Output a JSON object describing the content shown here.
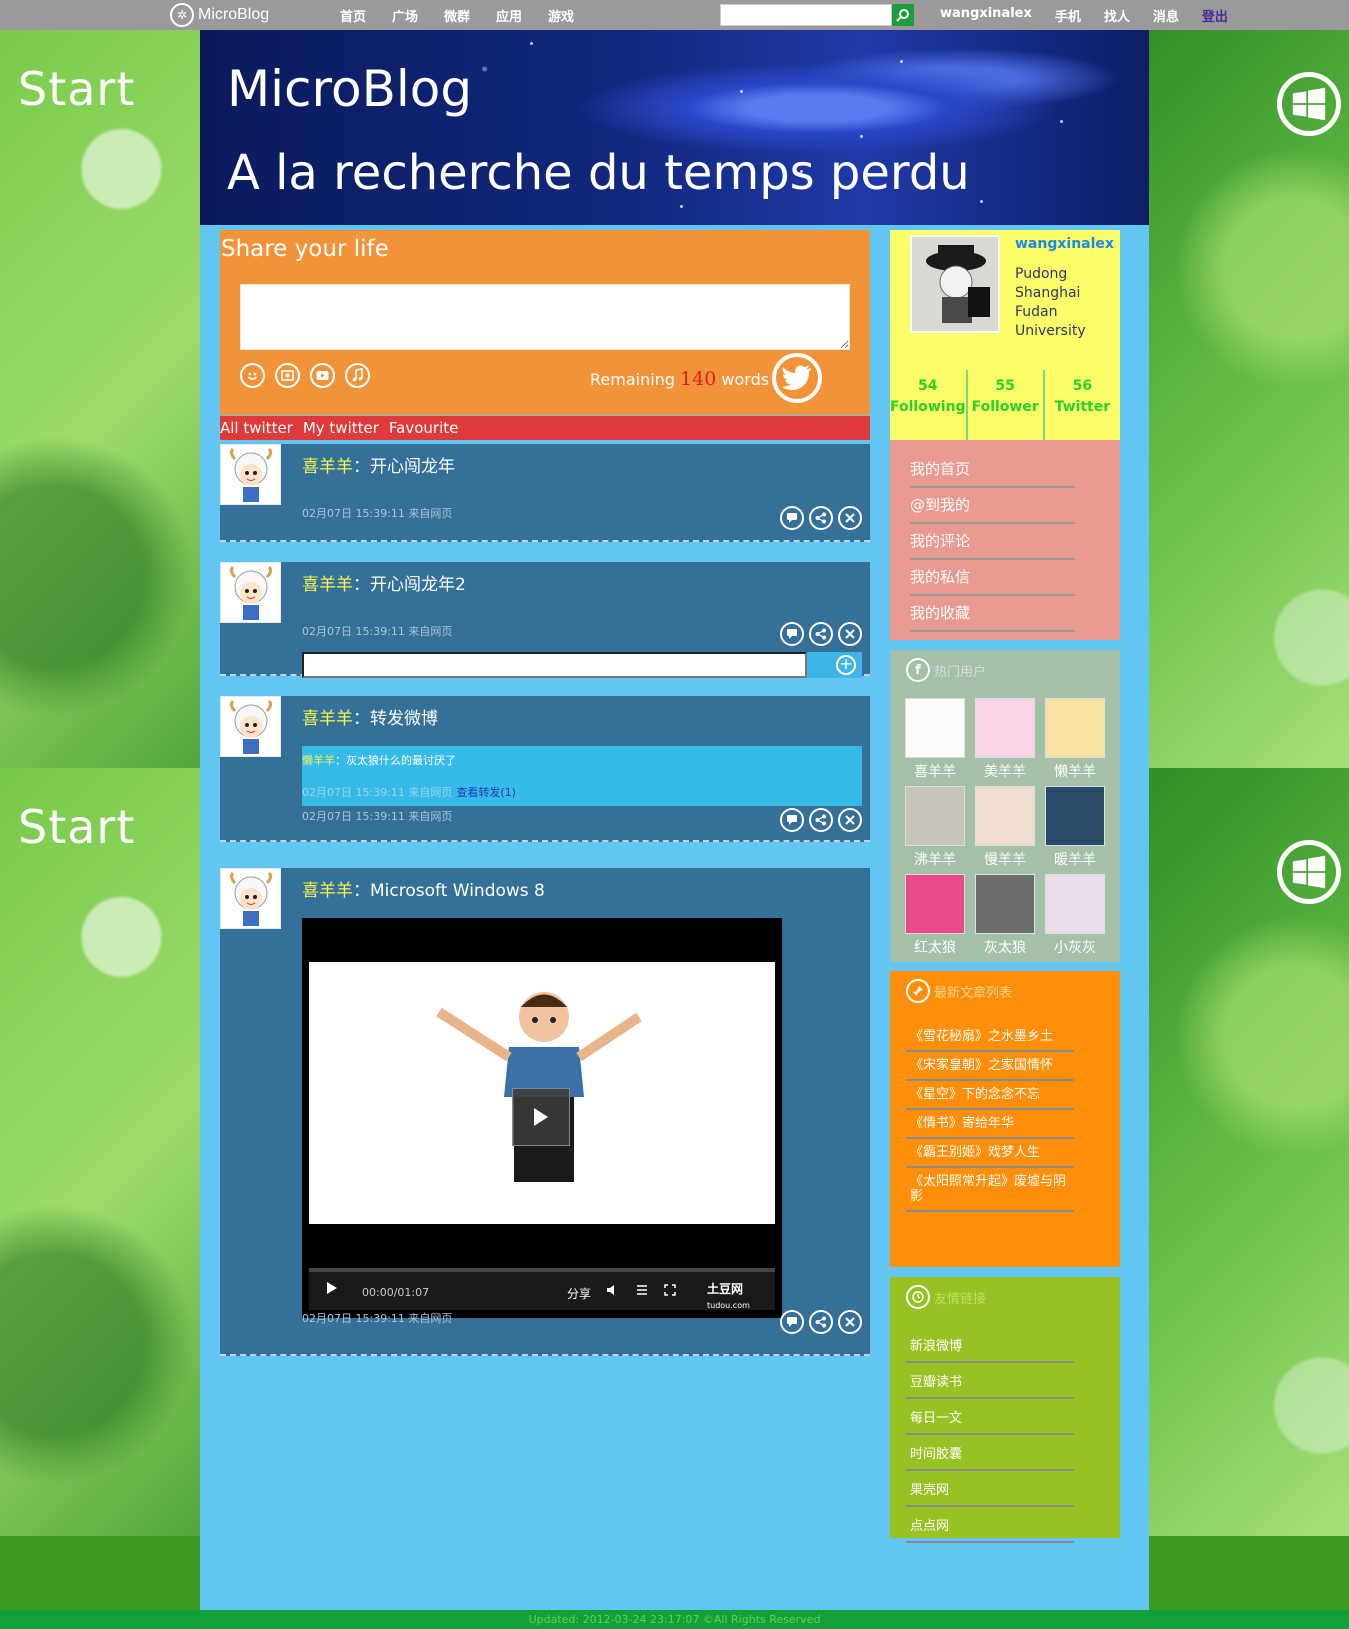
{
  "background": {
    "start_label_top": "Start",
    "start_label_bottom": "Start",
    "windows_logo_icon": "windows-logo-icon"
  },
  "topnav": {
    "brand": "MicroBlog",
    "links": [
      "首页",
      "广场",
      "微群",
      "应用",
      "游戏"
    ],
    "search_placeholder": "",
    "search_icon": "search-icon",
    "username": "wangxinalex",
    "user_links": [
      "手机",
      "找人",
      "消息"
    ],
    "logout": "登出"
  },
  "banner": {
    "title": "MicroBlog",
    "subtitle": "A la recherche du temps perdu"
  },
  "share": {
    "title": "Share your life",
    "input_value": "",
    "icons": [
      "smiley-icon",
      "image-icon",
      "video-icon",
      "music-icon"
    ],
    "remaining_prefix": "Remaining ",
    "remaining_count": "140",
    "remaining_suffix": " words",
    "post_button_icon": "twitter-bird-icon"
  },
  "tabs": [
    "All twitter",
    "My twitter",
    "Favourite"
  ],
  "posts": [
    {
      "author": "喜羊羊",
      "separator": "：",
      "text": "开心闯龙年",
      "meta": "02月07日 15:39:11 来自网页"
    },
    {
      "author": "喜羊羊",
      "separator": "：",
      "text": "开心闯龙年2",
      "meta": "02月07日 15:39:11 来自网页",
      "reply_value": ""
    },
    {
      "author": "喜羊羊",
      "separator": "：",
      "text": "转发微博",
      "repost": {
        "author": "懒羊羊",
        "separator": "：",
        "text": "灰太狼什么的最讨厌了",
        "meta": "02月07日 15:39:11 来自网页",
        "link": "查看转发(1)"
      },
      "meta": "02月07日 15:39:11 来自网页"
    },
    {
      "author": "喜羊羊",
      "separator": "：",
      "text": "Microsoft Windows 8",
      "video": {
        "time": "00:00/01:07",
        "share": "分享",
        "brand": "土豆网",
        "brand_sub": "tudou.com"
      },
      "meta": "02月07日 15:39:11 来自网页"
    }
  ],
  "post_action_icons": [
    "comment-icon",
    "share-icon",
    "delete-icon"
  ],
  "profile": {
    "username": "wangxinalex",
    "location": [
      "Pudong",
      "Shanghai",
      "Fudan",
      "University"
    ],
    "stats": [
      {
        "num": "54",
        "label": "Following"
      },
      {
        "num": "55",
        "label": "Follower"
      },
      {
        "num": "56",
        "label": "Twitter"
      }
    ]
  },
  "menu": [
    "我的首页",
    "@到我的",
    "我的评论",
    "我的私信",
    "我的收藏"
  ],
  "hot_users": {
    "title": "热门用户",
    "icon": "facebook-icon",
    "users": [
      "喜羊羊",
      "美羊羊",
      "懒羊羊",
      "沸羊羊",
      "慢羊羊",
      "暖羊羊",
      "红太狼",
      "灰太狼",
      "小灰灰"
    ]
  },
  "articles": {
    "title": "最新文章列表",
    "icon": "pin-icon",
    "items": [
      "《雪花秘扇》之水墨乡土",
      "《宋家皇朝》之家国情怀",
      "《星空》下的念念不忘",
      "《情书》寄给年华",
      "《霸王别姬》戏梦人生",
      "《太阳照常升起》废墟与阴影"
    ]
  },
  "links": {
    "title": "友情链接",
    "icon": "clock-icon",
    "items": [
      "新浪微博",
      "豆瓣读书",
      "每日一文",
      "时间胶囊",
      "果壳网",
      "点点网"
    ]
  },
  "footer": "Updated: 2012-03-24 23:17:07 ©All Rights Reserved"
}
